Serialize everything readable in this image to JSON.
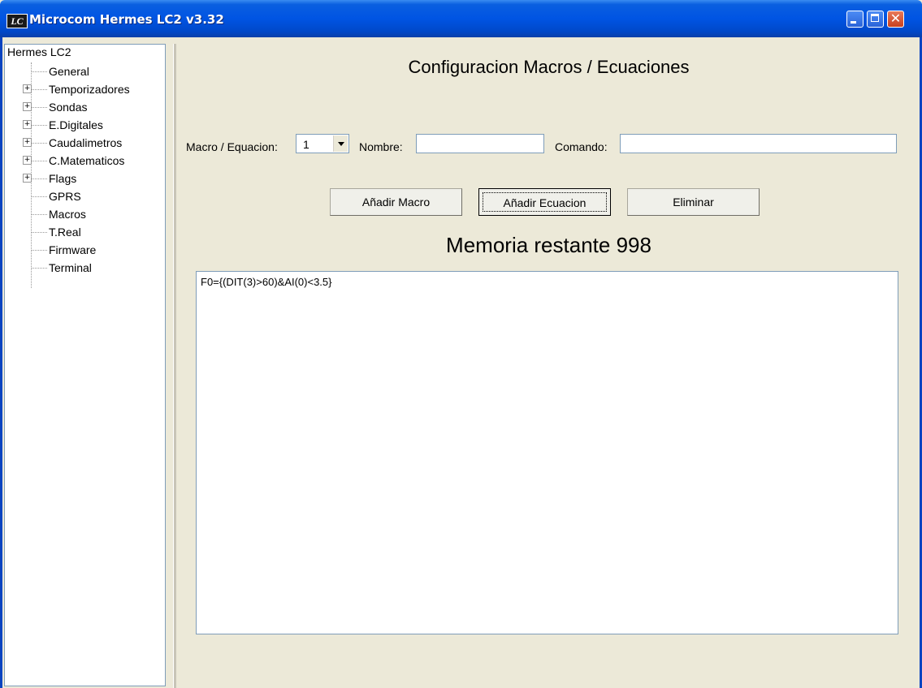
{
  "window": {
    "title": "Microcom Hermes LC2 v3.32",
    "app_icon": "LC",
    "close_glyph": "✕"
  },
  "tree": {
    "root": "Hermes LC2",
    "items": [
      {
        "label": "General",
        "expandable": false
      },
      {
        "label": "Temporizadores",
        "expandable": true
      },
      {
        "label": "Sondas",
        "expandable": true
      },
      {
        "label": "E.Digitales",
        "expandable": true
      },
      {
        "label": "Caudalimetros",
        "expandable": true
      },
      {
        "label": "C.Matematicos",
        "expandable": true
      },
      {
        "label": "Flags",
        "expandable": true
      },
      {
        "label": "GPRS",
        "expandable": false
      },
      {
        "label": "Macros",
        "expandable": false
      },
      {
        "label": "T.Real",
        "expandable": false
      },
      {
        "label": "Firmware",
        "expandable": false
      },
      {
        "label": "Terminal",
        "expandable": false
      }
    ],
    "expander_glyph": "+"
  },
  "main": {
    "title": "Configuracion Macros / Ecuaciones",
    "macro_label": "Macro / Equacion:",
    "macro_value": "1",
    "nombre_label": "Nombre:",
    "nombre_value": "",
    "comando_label": "Comando:",
    "comando_value": "",
    "buttons": {
      "add_macro": "Añadir Macro",
      "add_equation": "Añadir Ecuacion",
      "delete": "Eliminar"
    },
    "memory_text": "Memoria restante 998",
    "equations": [
      "F0={(DIT(3)>60)&AI(0)<3.5}"
    ]
  }
}
